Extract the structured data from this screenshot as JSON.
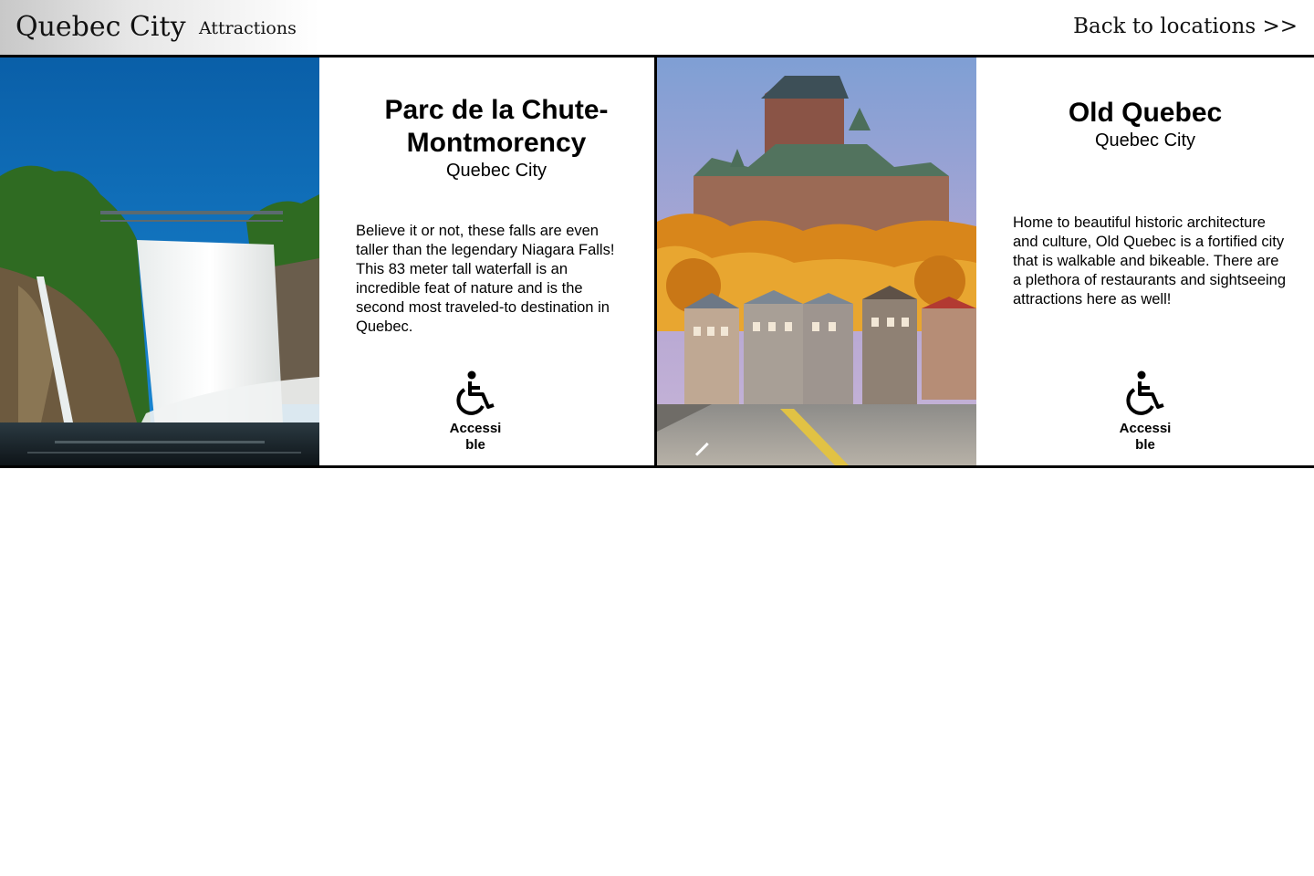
{
  "header": {
    "site_title": "Quebec City",
    "nav_attractions": "Attractions",
    "back_link": "Back to locations >>"
  },
  "attractions": [
    {
      "title": "Parc de la Chute-Montmorency",
      "city": "Quebec City",
      "description": "Believe it or not, these falls are even taller than the legendary Niagara Falls! This 83 meter tall waterfall is an incredible feat of nature and is the second most traveled-to destination in Quebec.",
      "badge_label": "Accessible",
      "badge_icon": "wheelchair-icon",
      "photo": "waterfall-photo"
    },
    {
      "title": "Old Quebec",
      "city": "Quebec City",
      "description": "Home to beautiful historic architecture and culture, Old Quebec is a fortified city that is walkable and bikeable. There are a plethora of restaurants and sightseeing attractions here as well!",
      "badge_label": "Accessible",
      "badge_icon": "wheelchair-icon",
      "photo": "old-quebec-photo"
    }
  ],
  "colors": {
    "border": "#000000",
    "header_gradient_start": "#c8c8c8"
  }
}
